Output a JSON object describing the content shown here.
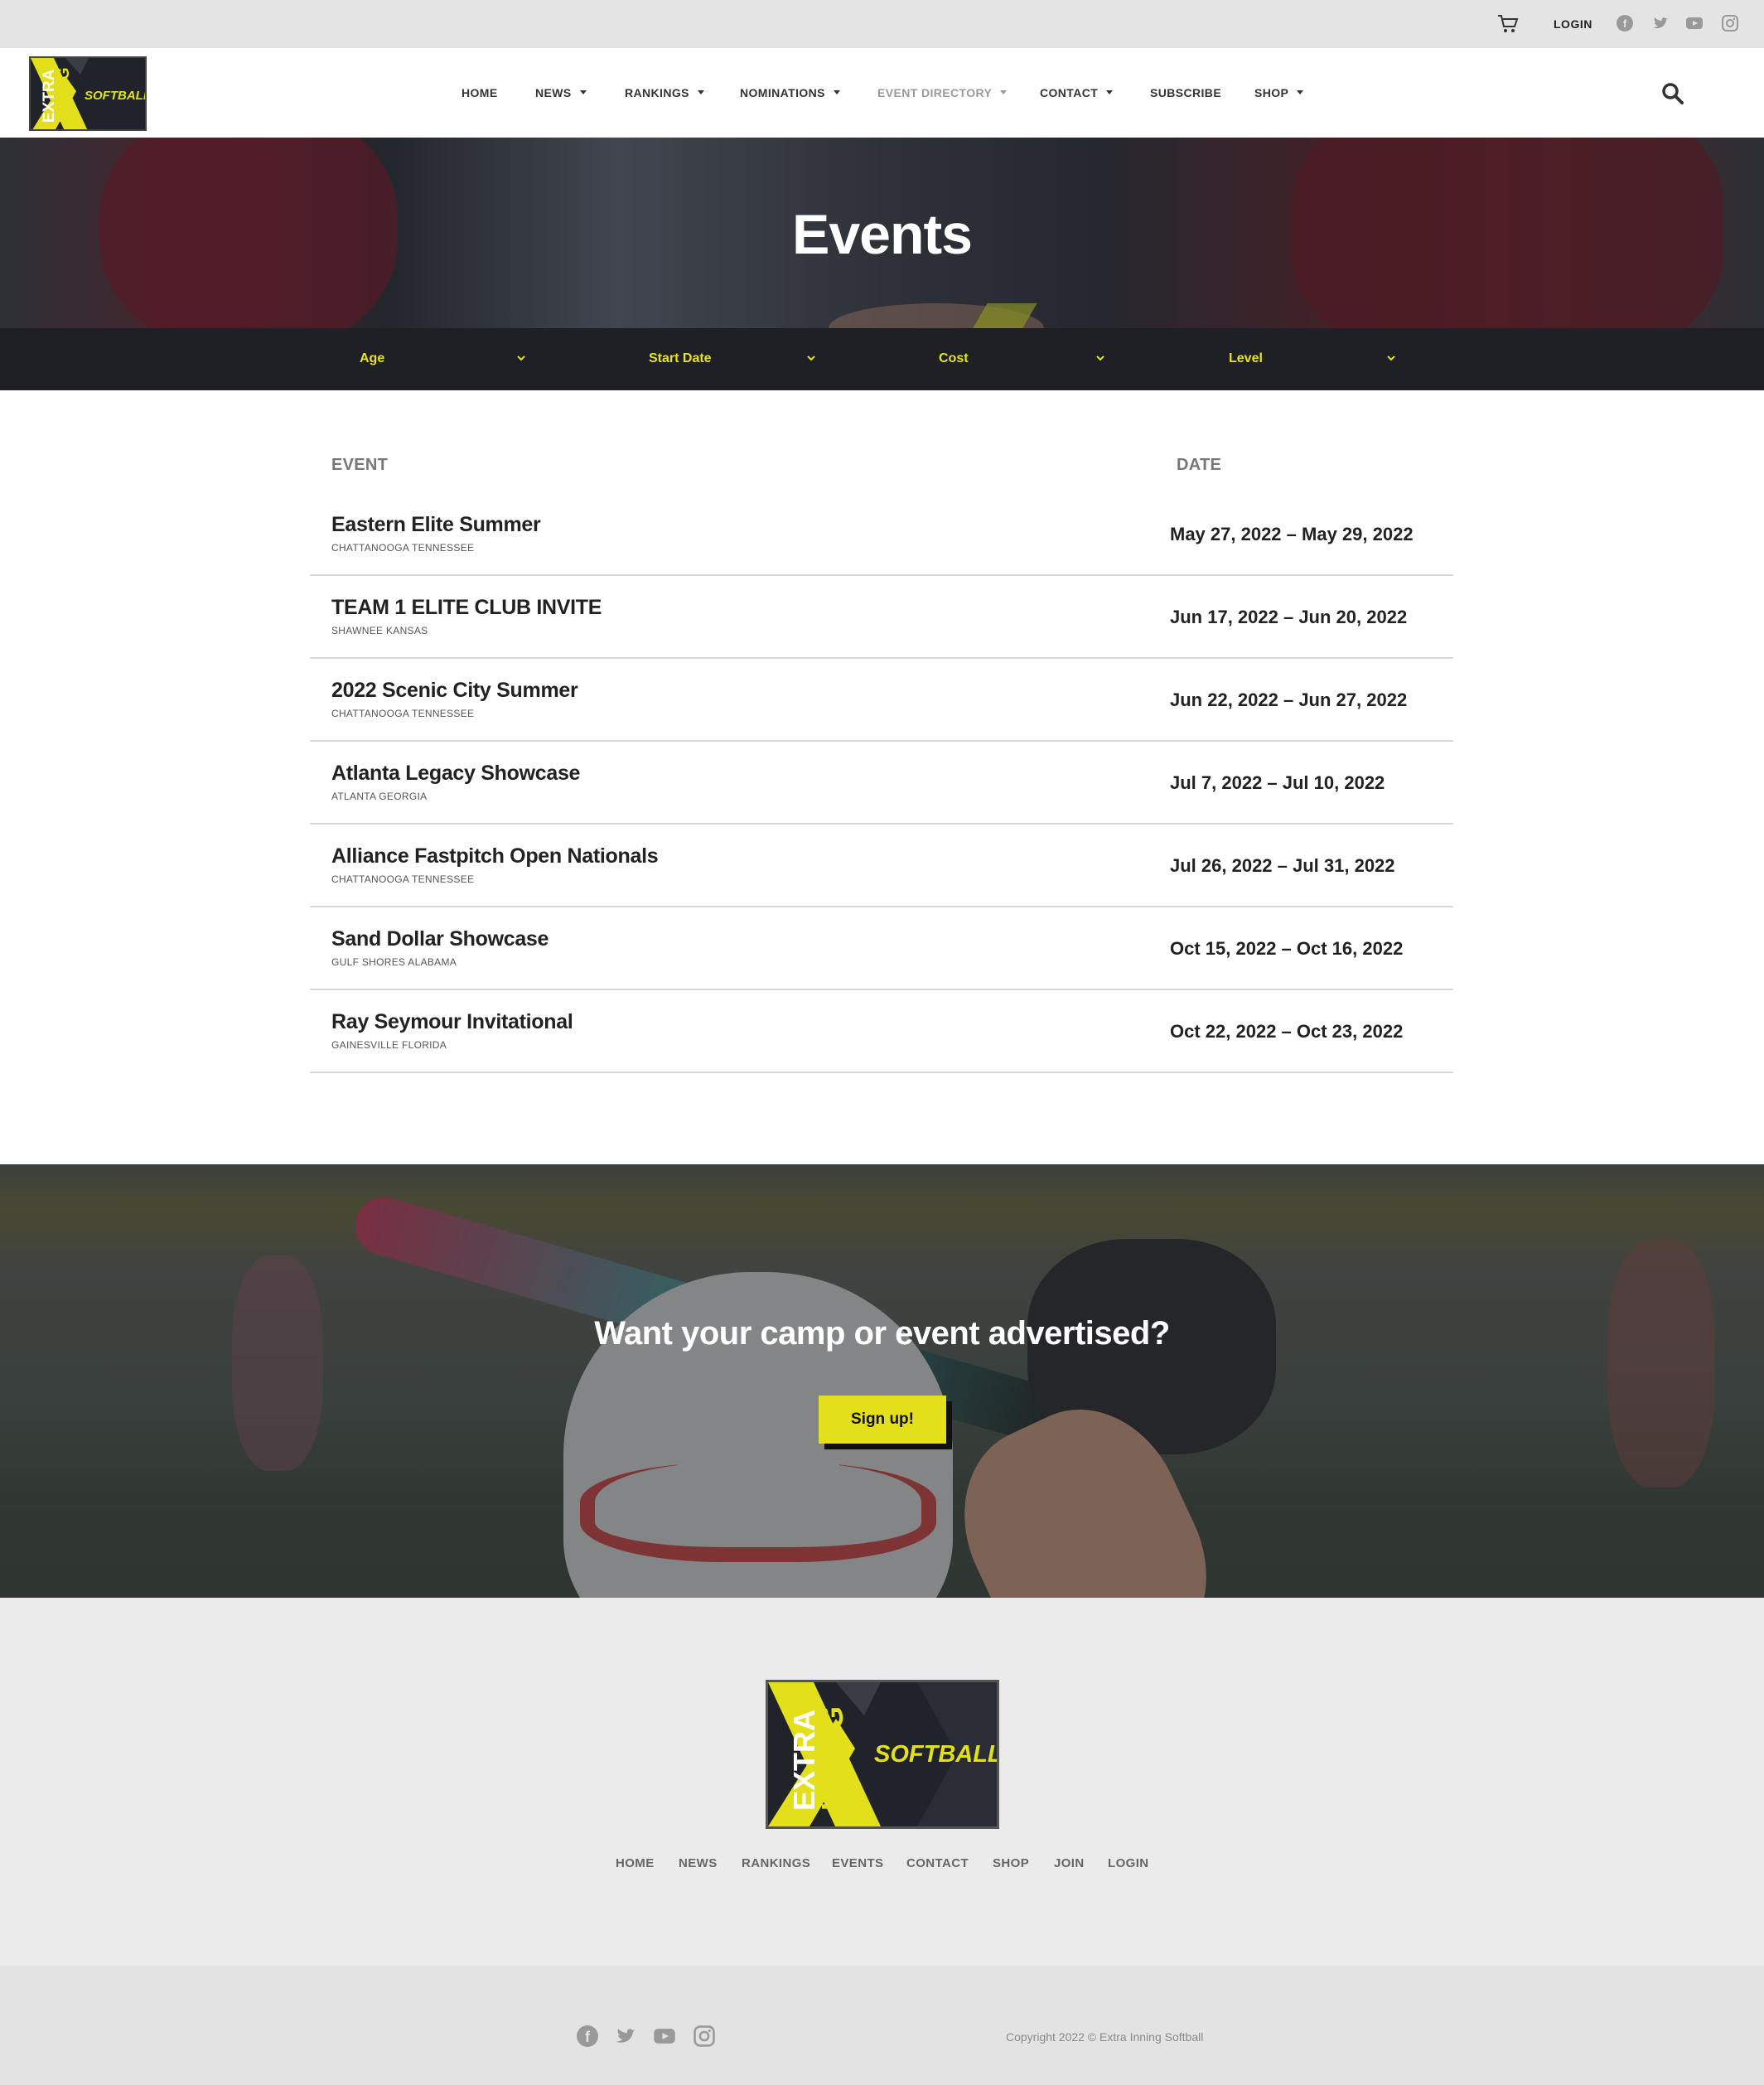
{
  "topbar": {
    "login_label": "LOGIN",
    "icons": [
      "cart-icon",
      "facebook-icon",
      "twitter-icon",
      "youtube-icon",
      "instagram-icon"
    ]
  },
  "brand": {
    "logo_line1": "EXTRA",
    "logo_line2": "INNING",
    "logo_word": "SOFTBALL",
    "accent_color": "#e3e01b",
    "dark_color": "#1e2026"
  },
  "nav": {
    "items": [
      {
        "label": "HOME",
        "dropdown": false
      },
      {
        "label": "NEWS",
        "dropdown": true
      },
      {
        "label": "RANKINGS",
        "dropdown": true
      },
      {
        "label": "NOMINATIONS",
        "dropdown": true
      },
      {
        "label": "EVENT DIRECTORY",
        "dropdown": true,
        "active": true
      },
      {
        "label": "CONTACT",
        "dropdown": true
      },
      {
        "label": "SUBSCRIBE",
        "dropdown": false
      },
      {
        "label": "SHOP",
        "dropdown": true
      }
    ]
  },
  "hero": {
    "title": "Events"
  },
  "filters": [
    {
      "label": "Age"
    },
    {
      "label": "Start Date"
    },
    {
      "label": "Cost"
    },
    {
      "label": "Level"
    }
  ],
  "table": {
    "headers": {
      "event": "EVENT",
      "date": "DATE"
    },
    "rows": [
      {
        "name": "Eastern Elite Summer",
        "location": "CHATTANOOGA TENNESSEE",
        "date": "May 27, 2022 – May 29, 2022"
      },
      {
        "name": "TEAM 1 ELITE CLUB INVITE",
        "location": "SHAWNEE KANSAS",
        "date": "Jun 17, 2022 – Jun 20, 2022"
      },
      {
        "name": "2022 Scenic City Summer",
        "location": "CHATTANOOGA TENNESSEE",
        "date": "Jun 22, 2022 – Jun 27, 2022"
      },
      {
        "name": "Atlanta Legacy Showcase",
        "location": "ATLANTA GEORGIA",
        "date": "Jul 7, 2022 – Jul 10, 2022"
      },
      {
        "name": "Alliance Fastpitch Open Nationals",
        "location": "CHATTANOOGA TENNESSEE",
        "date": "Jul 26, 2022 – Jul 31, 2022"
      },
      {
        "name": "Sand Dollar Showcase",
        "location": "GULF SHORES ALABAMA",
        "date": "Oct 15, 2022 – Oct 16, 2022"
      },
      {
        "name": "Ray Seymour Invitational",
        "location": "GAINESVILLE FLORIDA",
        "date": "Oct 22, 2022 – Oct 23, 2022"
      }
    ]
  },
  "cta": {
    "heading": "Want your camp or event advertised?",
    "button_label": "Sign up!"
  },
  "footer": {
    "nav": [
      "HOME",
      "NEWS",
      "RANKINGS",
      "EVENTS",
      "CONTACT",
      "SHOP",
      "JOIN",
      "LOGIN"
    ],
    "copyright": "Copyright 2022 © Extra Inning Softball"
  }
}
